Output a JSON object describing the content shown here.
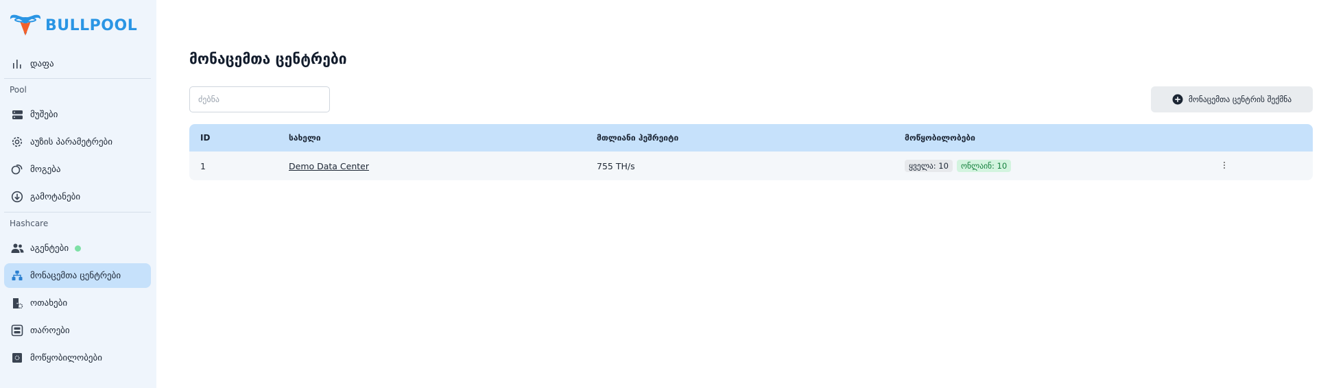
{
  "brand": {
    "name": "BULLPOOL",
    "color": "#2a95e4"
  },
  "sidebar": {
    "dashboard": "დაფა",
    "section_pool": "Pool",
    "pool_items": [
      {
        "label": "მუშები",
        "icon": "server-icon"
      },
      {
        "label": "აუზის პარამეტრები",
        "icon": "gear-icon"
      },
      {
        "label": "მოგება",
        "icon": "coins-icon"
      },
      {
        "label": "გამოტანები",
        "icon": "withdraw-icon"
      }
    ],
    "section_hashcare": "Hashcare",
    "hashcare_items": [
      {
        "label": "აგენტები",
        "icon": "users-icon",
        "status": "online"
      },
      {
        "label": "მონაცემთა ცენტრები",
        "icon": "sitemap-icon",
        "active": true
      },
      {
        "label": "ოთახები",
        "icon": "room-icon"
      },
      {
        "label": "თაროები",
        "icon": "rack-icon"
      },
      {
        "label": "მოწყობილობები",
        "icon": "device-icon"
      }
    ]
  },
  "main": {
    "title": "მონაცემთა ცენტრები",
    "search_placeholder": "ძებნა",
    "create_button": "მონაცემთა ცენტრის შექმნა",
    "table": {
      "headers": [
        "ID",
        "სახელი",
        "მთლიანი ჰეშრეიტი",
        "მოწყობილობები"
      ],
      "rows": [
        {
          "id": "1",
          "name": "Demo Data Center",
          "hashrate": "755 TH/s",
          "all": "ყველა: 10",
          "online": "ონლაინ: 10"
        }
      ]
    }
  },
  "colors": {
    "accent": "#2a95e4",
    "active_bg": "#c6e1fb",
    "sidebar_bg": "#eff5fc",
    "online_badge": "#d3f4df"
  }
}
